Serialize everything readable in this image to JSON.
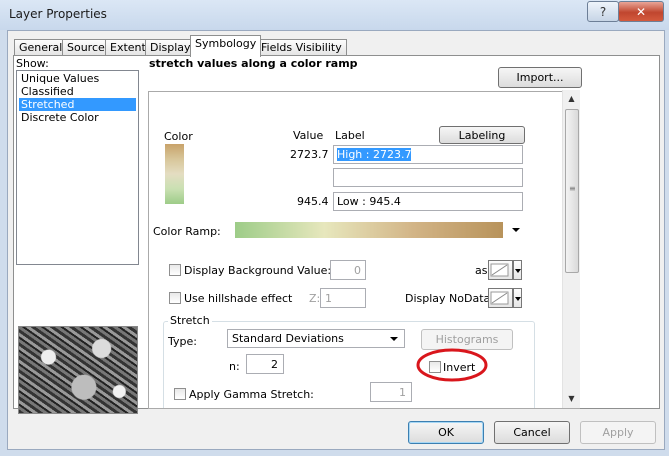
{
  "window": {
    "title": "Layer Properties"
  },
  "tabs": [
    "General",
    "Source",
    "Extent",
    "Display",
    "Symbology",
    "Fields Visibility"
  ],
  "active_tab": "Symbology",
  "show": {
    "label": "Show:",
    "items": [
      "Unique Values",
      "Classified",
      "Stretched",
      "Discrete Color"
    ],
    "selected": "Stretched"
  },
  "heading": "stretch values along a color ramp",
  "import_label": "Import...",
  "table": {
    "color_header": "Color",
    "value_header": "Value",
    "label_header": "Label",
    "labeling_button": "Labeling",
    "high_value": "2723.7",
    "high_label": "High : 2723.7",
    "low_value": "945.4",
    "low_label": "Low : 945.4",
    "ramp_colors": [
      "#c8a36a",
      "#d8c69a",
      "#e4ddc2",
      "#c9e0b2",
      "#9dcc88"
    ]
  },
  "color_ramp": {
    "label": "Color Ramp:",
    "colors": [
      "#9dcc88",
      "#e7e7bd",
      "#d2b486",
      "#b8935b"
    ]
  },
  "background": {
    "label": "Display Background Value:",
    "value": "0",
    "as_label": "as"
  },
  "hillshade": {
    "label": "Use hillshade effect",
    "z_label": "Z:",
    "z_value": "1"
  },
  "nodata": {
    "label": "Display NoData as"
  },
  "stretch": {
    "group_label": "Stretch",
    "type_label": "Type:",
    "type_value": "Standard Deviations",
    "histograms_label": "Histograms",
    "n_label": "n:",
    "n_value": "2",
    "invert_label": "Invert"
  },
  "gamma": {
    "label": "Apply Gamma Stretch:",
    "value": "1"
  },
  "buttons": {
    "ok": "OK",
    "cancel": "Cancel",
    "apply": "Apply"
  },
  "accent_colors": {
    "selection": "#3399ff",
    "highlight_ring": "#d9161c"
  }
}
